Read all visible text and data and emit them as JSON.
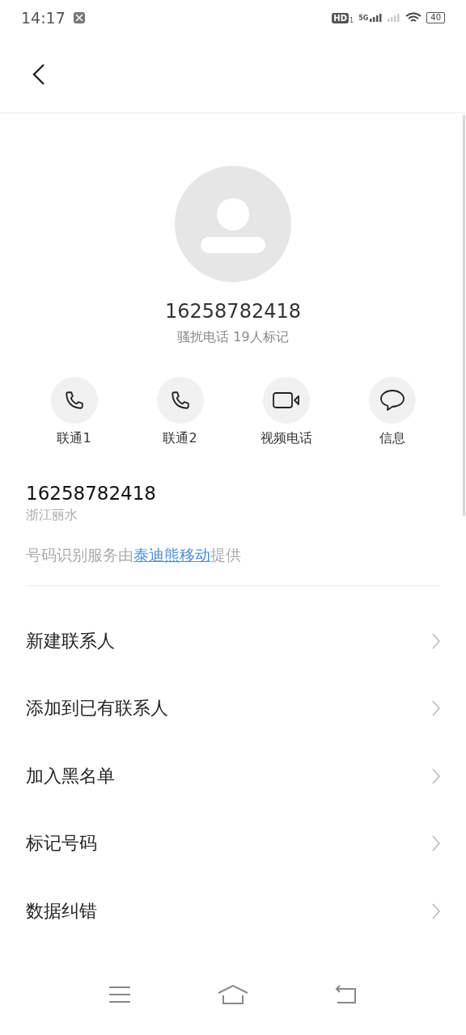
{
  "status_bar": {
    "time": "14:17",
    "hd": "HD",
    "hd_sim": "1",
    "network": "5G",
    "battery": "40"
  },
  "caller": {
    "number": "16258782418",
    "tag": "骚扰电话 19人标记"
  },
  "actions": [
    {
      "kind": "phone",
      "label": "联通1"
    },
    {
      "kind": "phone",
      "label": "联通2"
    },
    {
      "kind": "video",
      "label": "视频电话"
    },
    {
      "kind": "message",
      "label": "信息"
    }
  ],
  "number_info": {
    "number": "16258782418",
    "location": "浙江丽水"
  },
  "provider_note": {
    "before": "号码识别服务由",
    "link": "泰迪熊移动",
    "after": "提供"
  },
  "menu": [
    {
      "label": "新建联系人"
    },
    {
      "label": "添加到已有联系人"
    },
    {
      "label": "加入黑名单"
    },
    {
      "label": "标记号码"
    },
    {
      "label": "数据纠错"
    }
  ]
}
